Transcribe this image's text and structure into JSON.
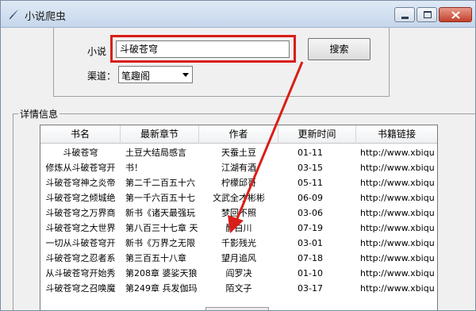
{
  "window": {
    "title": "小说爬虫"
  },
  "form": {
    "novel_label": "小说",
    "novel_value": "斗破苍穹",
    "search_label": "搜索",
    "channel_label": "渠道：",
    "channel_value": "笔趣阁"
  },
  "details": {
    "group_title": "详情信息",
    "columns": [
      "书名",
      "最新章节",
      "作者",
      "更新时间",
      "书籍链接"
    ],
    "rows": [
      [
        "斗破苍穹",
        "土豆大结局感言",
        "天蚕土豆",
        "01-11",
        "http://www.xbiqu"
      ],
      [
        "修炼从斗破苍穹开",
        "书！",
        "江湖有酒",
        "03-15",
        "http://www.xbiqu"
      ],
      [
        "斗破苍穹神之炎帝",
        "第二千二百五十六",
        "柠檬邱哥",
        "05-11",
        "http://www.xbiqu"
      ],
      [
        "斗破苍穹之倾城绝",
        "第一千六百五十七",
        "文武全才彬彬",
        "06-09",
        "http://www.xbiqu"
      ],
      [
        "斗破苍穹之万界商",
        "新书《诸天最强玩",
        "梦回不照",
        "03-06",
        "http://www.xbiqu"
      ],
      [
        "斗破苍穹之大世界",
        "第八百三十七章 天",
        "醉白川",
        "07-19",
        "http://www.xbiqu"
      ],
      [
        "一切从斗破苍穹开",
        "新书《万界之无限",
        "千影残光",
        "03-01",
        "http://www.xbiqu"
      ],
      [
        "斗破苍穹之忍者系",
        "第三百五十八章 ",
        "望月追风",
        "07-18",
        "http://www.xbiqu"
      ],
      [
        "从斗破苍穹开始秀",
        "第208章 婆娑天狼",
        "阎罗决",
        "01-10",
        "http://www.xbiqu"
      ],
      [
        "斗破苍穹之召唤魔",
        "第249章 兵发伽玛",
        "陌文子",
        "03-17",
        "http://www.xbiqu"
      ]
    ]
  },
  "colors": {
    "highlight": "#d91e18",
    "arrow": "#d91e18"
  }
}
